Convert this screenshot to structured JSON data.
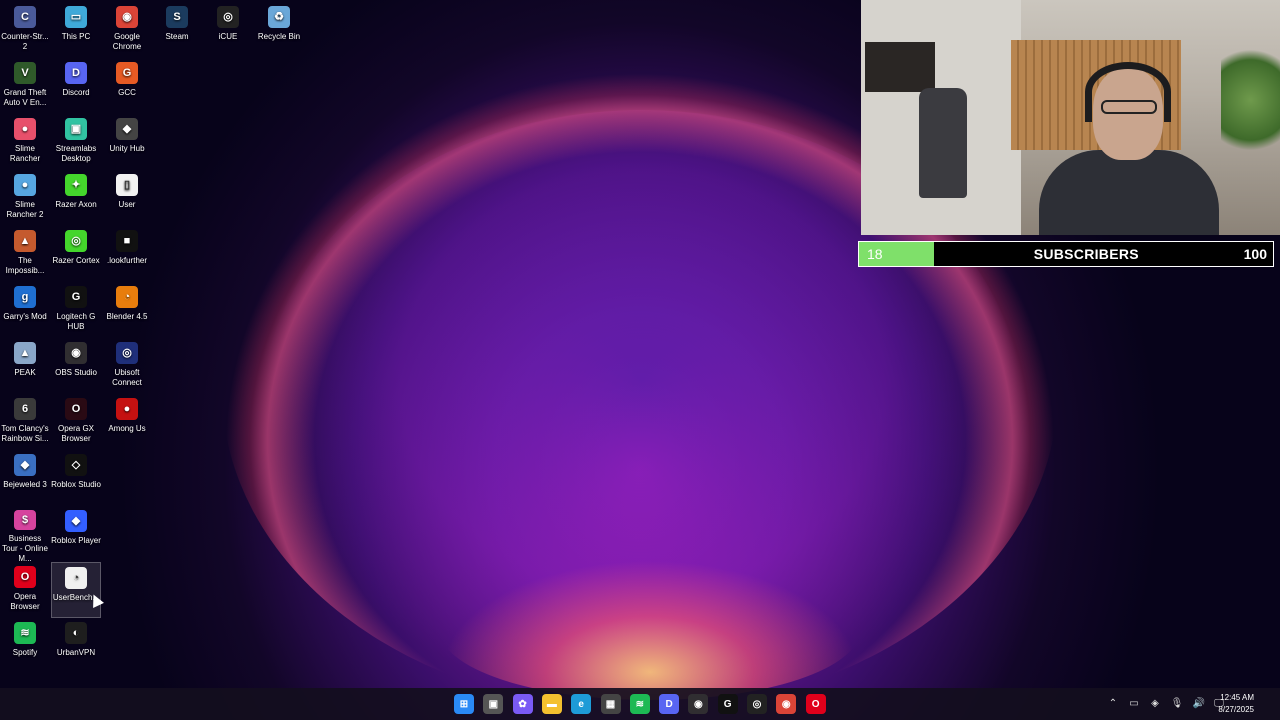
{
  "desktop_icons": [
    {
      "label": "Counter-Str... 2",
      "icon": "cs2-icon",
      "color": "#4a5a9a",
      "glyph": "C"
    },
    {
      "label": "This PC",
      "icon": "monitor-icon",
      "color": "#3fa9d9",
      "glyph": "▭"
    },
    {
      "label": "Google Chrome",
      "icon": "chrome-icon",
      "color": "#db4437",
      "glyph": "◉"
    },
    {
      "label": "Steam",
      "icon": "steam-icon",
      "color": "#1b3b5e",
      "glyph": "S"
    },
    {
      "label": "iCUE",
      "icon": "icue-icon",
      "color": "#222222",
      "glyph": "◎"
    },
    {
      "label": "Recycle Bin",
      "icon": "recycle-bin-icon",
      "color": "#6aa7d8",
      "glyph": "♻"
    },
    {
      "label": "Grand Theft Auto V En...",
      "icon": "gta-icon",
      "color": "#2f5a2a",
      "glyph": "V"
    },
    {
      "label": "Discord",
      "icon": "discord-icon",
      "color": "#5865f2",
      "glyph": "D"
    },
    {
      "label": "GCC",
      "icon": "gcc-icon",
      "color": "#e65a24",
      "glyph": "G"
    },
    {
      "label": "Slime Rancher",
      "icon": "slime-rancher-icon",
      "color": "#e7506b",
      "glyph": "●"
    },
    {
      "label": "Streamlabs Desktop",
      "icon": "streamlabs-icon",
      "color": "#31c3a2",
      "glyph": "▣"
    },
    {
      "label": "Unity Hub",
      "icon": "unity-icon",
      "color": "#444444",
      "glyph": "◆"
    },
    {
      "label": "Slime Rancher 2",
      "icon": "slime-rancher-2-icon",
      "color": "#57a6e0",
      "glyph": "●"
    },
    {
      "label": "Razer Axon",
      "icon": "razer-axon-icon",
      "color": "#44d62c",
      "glyph": "✦"
    },
    {
      "label": "User",
      "icon": "file-icon",
      "color": "#f2f2f2",
      "glyph": "▯"
    },
    {
      "label": "The Impossib...",
      "icon": "impossible-game-icon",
      "color": "#c55a2e",
      "glyph": "▲"
    },
    {
      "label": "Razer Cortex",
      "icon": "razer-cortex-icon",
      "color": "#44d62c",
      "glyph": "◎"
    },
    {
      "label": ".lookfurther",
      "icon": "lookfurther-icon",
      "color": "#111111",
      "glyph": "■"
    },
    {
      "label": "Garry's Mod",
      "icon": "garrys-mod-icon",
      "color": "#1f6fd1",
      "glyph": "g"
    },
    {
      "label": "Logitech G HUB",
      "icon": "logitech-icon",
      "color": "#111111",
      "glyph": "G"
    },
    {
      "label": "Blender 4.5",
      "icon": "blender-icon",
      "color": "#e87d0d",
      "glyph": "◔"
    },
    {
      "label": "PEAK",
      "icon": "peak-icon",
      "color": "#8aa7c9",
      "glyph": "▲"
    },
    {
      "label": "OBS Studio",
      "icon": "obs-icon",
      "color": "#302e31",
      "glyph": "◉"
    },
    {
      "label": "Ubisoft Connect",
      "icon": "ubisoft-icon",
      "color": "#1f2f7a",
      "glyph": "◎"
    },
    {
      "label": "Tom Clancy's Rainbow Si...",
      "icon": "rainbow-six-icon",
      "color": "#3a3a3a",
      "glyph": "6"
    },
    {
      "label": "Opera GX Browser",
      "icon": "opera-gx-icon",
      "color": "#2a0a14",
      "glyph": "O"
    },
    {
      "label": "Among Us",
      "icon": "among-us-icon",
      "color": "#c51111",
      "glyph": "●"
    },
    {
      "label": "Bejeweled 3",
      "icon": "bejeweled-icon",
      "color": "#3a6fc1",
      "glyph": "◆"
    },
    {
      "label": "Roblox Studio",
      "icon": "roblox-studio-icon",
      "color": "#111111",
      "glyph": "◇"
    },
    {
      "label": "Business Tour - Online M...",
      "icon": "business-tour-icon",
      "color": "#d6439e",
      "glyph": "$"
    },
    {
      "label": "Roblox Player",
      "icon": "roblox-player-icon",
      "color": "#335fff",
      "glyph": "◆"
    },
    {
      "label": "Opera Browser",
      "icon": "opera-icon",
      "color": "#e0001b",
      "glyph": "O"
    },
    {
      "label": "UserBench...",
      "icon": "userbenchmark-icon",
      "color": "#f0f0f0",
      "glyph": "◔"
    },
    {
      "label": "Spotify",
      "icon": "spotify-icon",
      "color": "#1db954",
      "glyph": "≋"
    },
    {
      "label": "UrbanVPN",
      "icon": "urbanvpn-icon",
      "color": "#1e1e1e",
      "glyph": "◐"
    }
  ],
  "subscriber_goal": {
    "current": "18",
    "label": "SUBSCRIBERS",
    "goal": "100",
    "progress_fraction": 0.18,
    "fill_color": "#7fe06a"
  },
  "taskbar": {
    "apps": [
      {
        "name": "start-button",
        "icon": "windows-icon",
        "color": "#2a8af6",
        "glyph": "⊞"
      },
      {
        "name": "task-view",
        "icon": "task-view-icon",
        "color": "#555555",
        "glyph": "▣"
      },
      {
        "name": "copilot",
        "icon": "copilot-icon",
        "color": "#7a5af5",
        "glyph": "✿"
      },
      {
        "name": "file-explorer",
        "icon": "folder-icon",
        "color": "#f4c02f",
        "glyph": "▬"
      },
      {
        "name": "edge",
        "icon": "edge-icon",
        "color": "#1e9bd7",
        "glyph": "e"
      },
      {
        "name": "microsoft-store",
        "icon": "store-icon",
        "color": "#444444",
        "glyph": "▦"
      },
      {
        "name": "spotify",
        "icon": "spotify-icon",
        "color": "#1db954",
        "glyph": "≋"
      },
      {
        "name": "discord",
        "icon": "discord-icon",
        "color": "#5865f2",
        "glyph": "D"
      },
      {
        "name": "obs",
        "icon": "obs-icon",
        "color": "#302e31",
        "glyph": "◉"
      },
      {
        "name": "logitech",
        "icon": "logitech-icon",
        "color": "#111111",
        "glyph": "G"
      },
      {
        "name": "icue",
        "icon": "icue-icon",
        "color": "#222222",
        "glyph": "◎"
      },
      {
        "name": "chrome",
        "icon": "chrome-icon",
        "color": "#db4437",
        "glyph": "◉"
      },
      {
        "name": "opera",
        "icon": "opera-icon",
        "color": "#e0001b",
        "glyph": "O"
      }
    ],
    "tray_icons": [
      "chevron-up-icon",
      "battery-icon",
      "shield-icon",
      "microphone-icon",
      "volume-icon",
      "network-icon"
    ],
    "tray_glyphs": [
      "⌃",
      "▭",
      "◈",
      "🎙",
      "🔊",
      "🖵"
    ],
    "time": "12:45 AM",
    "date": "8/27/2025"
  }
}
